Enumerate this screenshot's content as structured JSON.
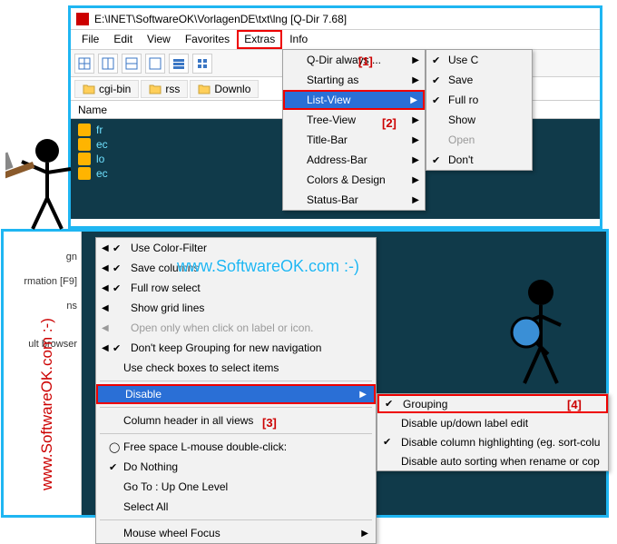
{
  "window": {
    "title": "E:\\INET\\SoftwareOK\\VorlagenDE\\txt\\lng  [Q-Dir 7.68]"
  },
  "menubar": [
    "File",
    "Edit",
    "View",
    "Favorites",
    "Extras",
    "Info"
  ],
  "tabs": [
    "cgi-bin",
    "rss",
    "Downlo"
  ],
  "column_header": "Name",
  "files": [
    "fr",
    "ec",
    "lo",
    "ec"
  ],
  "dd1": {
    "items": [
      "Q-Dir always ...",
      "Starting as",
      "List-View",
      "Tree-View",
      "Title-Bar",
      "Address-Bar",
      "Colors & Design",
      "Status-Bar"
    ],
    "highlight_index": 2
  },
  "dd2": {
    "items": [
      {
        "label": "Use C",
        "check": true
      },
      {
        "label": "Save",
        "check": true
      },
      {
        "label": "Full ro",
        "check": true
      },
      {
        "label": "Show",
        "check": false
      },
      {
        "label": "Open",
        "check": false,
        "disabled": true
      },
      {
        "label": "Don't",
        "check": true
      }
    ]
  },
  "frame2_left": [
    "",
    "gn",
    "rmation  [F9]",
    "ns",
    "",
    "ult browser"
  ],
  "dd3": {
    "items": [
      {
        "label": "Use Color-Filter",
        "check": true,
        "arrow": true
      },
      {
        "label": "Save columns",
        "check": true,
        "arrow": true
      },
      {
        "label": "Full row select",
        "check": true,
        "arrow": true
      },
      {
        "label": "Show grid lines",
        "arrow": true
      },
      {
        "label": "Open only when click on label or icon.",
        "disabled": true,
        "arrow": true
      },
      {
        "label": "Don't keep Grouping for new navigation",
        "check": true,
        "arrow": true
      },
      {
        "label": "Use check boxes to select items"
      },
      {
        "sep": true
      },
      {
        "label": "Disable",
        "hl": true,
        "arrow_right": true
      },
      {
        "sep": true
      },
      {
        "label": "Column header in all views"
      },
      {
        "sep": true
      },
      {
        "label": "Free space L-mouse double-click:",
        "radio": true
      },
      {
        "label": "Do Nothing",
        "check": true
      },
      {
        "label": "Go To : Up One Level"
      },
      {
        "label": "Select All"
      },
      {
        "sep": true
      },
      {
        "label": "Mouse wheel Focus",
        "arrow_right": true
      }
    ]
  },
  "dd4": {
    "items": [
      {
        "label": "Grouping",
        "check": true,
        "hl": true
      },
      {
        "label": "Disable up/down label edit"
      },
      {
        "label": "Disable column highlighting (eg. sort-colu",
        "check": true
      },
      {
        "label": "Disable auto sorting when rename or cop"
      }
    ]
  },
  "annotations": {
    "a1": "[1]",
    "a2": "[2]",
    "a3": "[3]",
    "a4": "[4]"
  },
  "watermark": "www.SoftwareOK.com :-)"
}
